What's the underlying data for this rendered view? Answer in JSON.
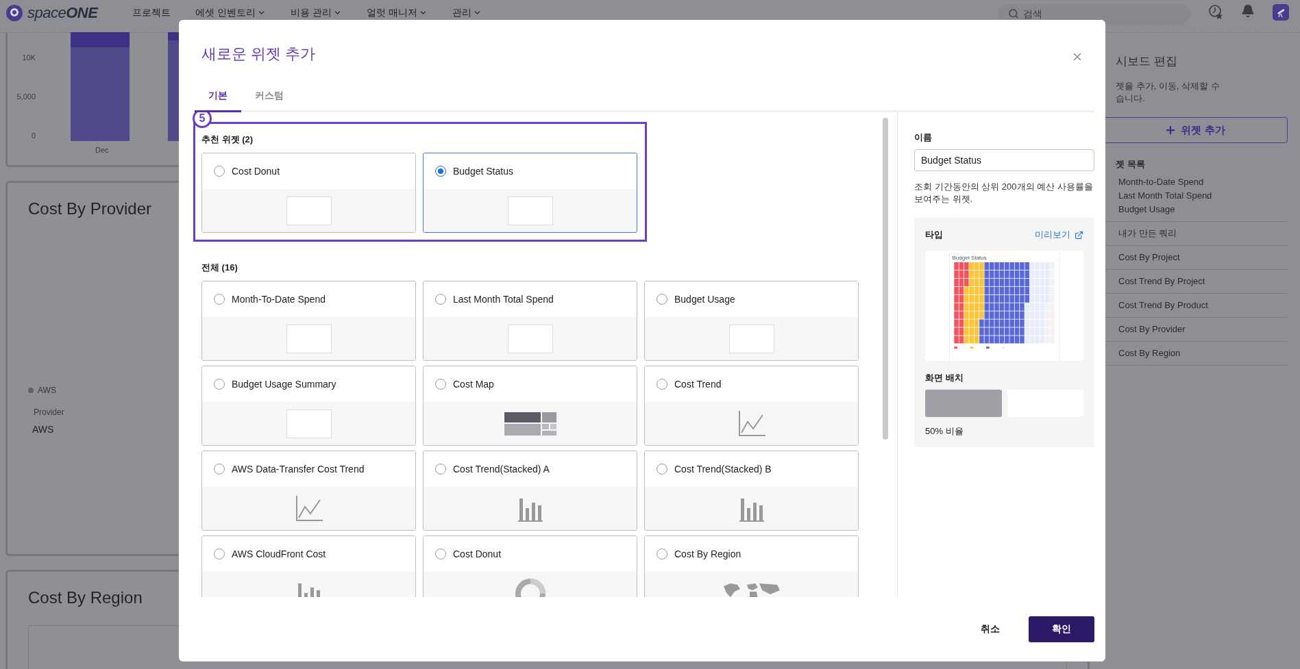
{
  "nav": {
    "logo": "space**ONE**",
    "menu": [
      {
        "label": "프로젝트",
        "has_menu": false
      },
      {
        "label": "에셋 인벤토리",
        "has_menu": true
      },
      {
        "label": "비용 관리",
        "has_menu": true
      },
      {
        "label": "얼럿 매니저",
        "has_menu": true
      },
      {
        "label": "관리",
        "has_menu": true
      }
    ],
    "search": {
      "placeholder": "검색"
    }
  },
  "dashboard": {
    "top_chart": {
      "y_ticks": [
        "10K",
        "5,000",
        "0"
      ],
      "x_labels": [
        "Dec"
      ]
    },
    "cards": [
      {
        "title": "Cost By Provider",
        "kind": "provider",
        "legend": "AWS",
        "column_label": "Provider",
        "value": "AWS"
      },
      {
        "title": "Cost By Region",
        "kind": "map"
      }
    ]
  },
  "edit_panel": {
    "title": "시보드 편집",
    "description": [
      "젯을 추가, 이동, 삭제할 수",
      "습니다."
    ],
    "add_button": "위젯 추가",
    "list_title": "젯 목록",
    "list": [
      {
        "lines": [
          "Month-to-Date Spend",
          "Last Month Total Spend",
          "Budget Usage"
        ]
      },
      {
        "lines": [
          "내가 만든 쿼리"
        ]
      },
      {
        "lines": [
          "Cost By Project"
        ]
      },
      {
        "lines": [
          "Cost Trend By Project"
        ]
      },
      {
        "lines": [
          "Cost Trend By Product"
        ]
      },
      {
        "lines": [
          "Cost By Provider"
        ]
      },
      {
        "lines": [
          "Cost By Region"
        ]
      }
    ]
  },
  "modal": {
    "title": "새로운 위젯 추가",
    "tabs": [
      {
        "label": "기본",
        "selected": true
      },
      {
        "label": "커스텀",
        "selected": false
      }
    ],
    "sections": [
      {
        "title": "추천 위젯 (2)",
        "annotation": {
          "label": "5"
        },
        "widgets": [
          {
            "name": "Cost Donut",
            "selected": false,
            "kind": "blank"
          },
          {
            "name": "Budget Status",
            "selected": true,
            "kind": "blank"
          }
        ]
      },
      {
        "title": "전체 (16)",
        "widgets": [
          {
            "name": "Month-To-Date Spend",
            "selected": false,
            "kind": "blank"
          },
          {
            "name": "Last Month Total Spend",
            "selected": false,
            "kind": "blank"
          },
          {
            "name": "Budget Usage",
            "selected": false,
            "kind": "blank"
          },
          {
            "name": "Budget Usage Summary",
            "selected": false,
            "kind": "blank"
          },
          {
            "name": "Cost Map",
            "selected": false,
            "kind": "treemap"
          },
          {
            "name": "Cost Trend",
            "selected": false,
            "kind": "line"
          },
          {
            "name": "AWS Data-Transfer Cost Trend",
            "selected": false,
            "kind": "line"
          },
          {
            "name": "Cost Trend(Stacked) A",
            "selected": false,
            "kind": "bar"
          },
          {
            "name": "Cost Trend(Stacked) B",
            "selected": false,
            "kind": "bar"
          },
          {
            "name": "AWS CloudFront Cost",
            "selected": false,
            "kind": "bar"
          },
          {
            "name": "Cost Donut",
            "selected": false,
            "kind": "donut"
          },
          {
            "name": "Cost By Region",
            "selected": false,
            "kind": "map"
          }
        ]
      }
    ],
    "detail": {
      "name_label": "이름",
      "name_value": "Budget Status",
      "description": "조회 기간동안의 상위 200개의 예산 사용률을 보여주는 위젯.",
      "type_label": "타입",
      "preview_link": "미리보기",
      "preview_title": "Budget Status",
      "layout_label": "화면 배치",
      "layout_options": [
        {
          "selected": true
        },
        {
          "selected": false
        }
      ],
      "layout_caption": "50% 비율"
    },
    "footer": {
      "cancel": "취소",
      "confirm": "확인"
    }
  }
}
